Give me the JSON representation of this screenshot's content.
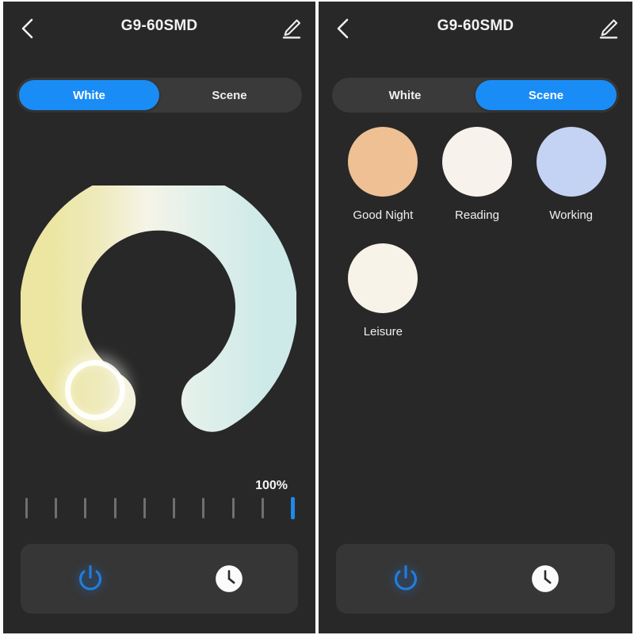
{
  "theme": {
    "panel_bg": "#282828",
    "accent_blue": "#1a8cf5",
    "tab_track": "#3a3a3a",
    "bottom_bar_bg": "#363636",
    "text_primary": "#f2f2f2"
  },
  "panels": [
    {
      "id": "white-mode",
      "header": {
        "title": "G9-60SMD",
        "back_icon": "chevron-left-icon",
        "edit_icon": "pencil-edit-icon"
      },
      "tabs": [
        {
          "label": "White",
          "active": true
        },
        {
          "label": "Scene",
          "active": false
        }
      ],
      "color_wheel": {
        "gradient_warm": "#ece9a8",
        "gradient_mid": "#f6f5ef",
        "gradient_cool": "#cfeaea",
        "handle_position_deg": 212
      },
      "brightness": {
        "value_label": "100%",
        "ticks": 10,
        "active_tick_index": 9
      },
      "bottom_bar": [
        {
          "icon": "power-icon",
          "state": "on"
        },
        {
          "icon": "timer-clock-icon",
          "state": "default"
        }
      ]
    },
    {
      "id": "scene-mode",
      "header": {
        "title": "G9-60SMD",
        "back_icon": "chevron-left-icon",
        "edit_icon": "pencil-edit-icon"
      },
      "tabs": [
        {
          "label": "White",
          "active": false
        },
        {
          "label": "Scene",
          "active": true
        }
      ],
      "scenes": [
        {
          "label": "Good Night",
          "color": "#efc094"
        },
        {
          "label": "Reading",
          "color": "#f7f3ec"
        },
        {
          "label": "Working",
          "color": "#c4d2f3"
        },
        {
          "label": "Leisure",
          "color": "#f8f3e9"
        }
      ],
      "bottom_bar": [
        {
          "icon": "power-icon",
          "state": "on"
        },
        {
          "icon": "timer-clock-icon",
          "state": "default"
        }
      ]
    }
  ]
}
